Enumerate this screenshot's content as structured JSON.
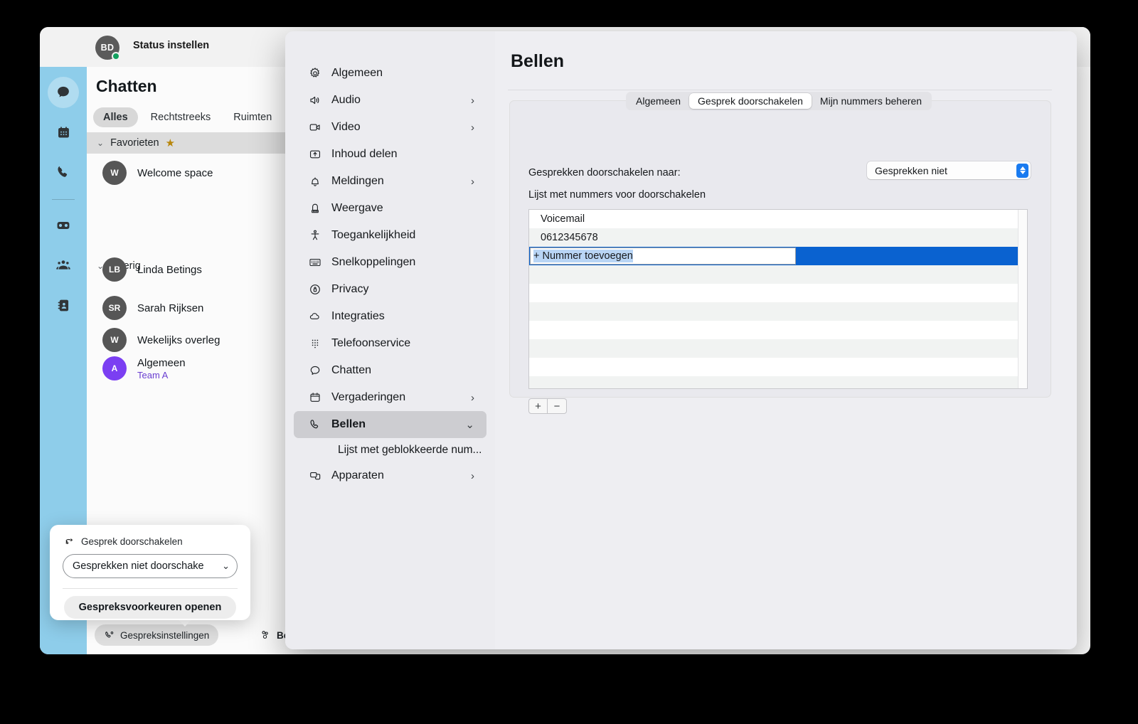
{
  "app": {
    "avatar_initials": "BD",
    "status_label": "Status instellen",
    "chat_title": "Chatten",
    "chat_tabs": [
      {
        "label": "Alles",
        "selected": true
      },
      {
        "label": "Rechtstreeks",
        "selected": false
      },
      {
        "label": "Ruimten",
        "selected": false
      }
    ],
    "groups": {
      "favorites_label": "Favorieten",
      "other_label": "Overig"
    },
    "favorites": [
      {
        "initials": "W",
        "name": "Welcome space",
        "color": "gray",
        "sub": ""
      }
    ],
    "other": [
      {
        "initials": "LB",
        "name": "Linda Betings",
        "color": "gray",
        "sub": ""
      },
      {
        "initials": "SR",
        "name": "Sarah Rijksen",
        "color": "gray",
        "sub": ""
      },
      {
        "initials": "W",
        "name": "Wekelijks overleg",
        "color": "gray",
        "sub": ""
      },
      {
        "initials": "A",
        "name": "Algemeen",
        "color": "purple",
        "sub": "Team A"
      }
    ],
    "rail_items": [
      {
        "name": "chat",
        "active": true
      },
      {
        "name": "calendar",
        "active": false
      },
      {
        "name": "calls",
        "active": false
      },
      {
        "name": "voicemail",
        "active": false
      },
      {
        "name": "teams",
        "active": false
      },
      {
        "name": "contacts",
        "active": false
      }
    ],
    "bottom_bar": {
      "call_settings_label": "Gespreksinstellingen",
      "availability_label": "Beschikbaar"
    },
    "popover": {
      "header_label": "Gesprek doorschakelen",
      "select_value": "Gesprekken niet doorschake",
      "button_label": "Gespreksvoorkeuren openen"
    }
  },
  "settings": {
    "nav": [
      {
        "label": "Algemeen",
        "icon": "gear-icon",
        "chevron": "",
        "selected": false
      },
      {
        "label": "Audio",
        "icon": "speaker-icon",
        "chevron": "›",
        "selected": false
      },
      {
        "label": "Video",
        "icon": "camera-icon",
        "chevron": "›",
        "selected": false
      },
      {
        "label": "Inhoud delen",
        "icon": "share-screen-icon",
        "chevron": "",
        "selected": false
      },
      {
        "label": "Meldingen",
        "icon": "bell-icon",
        "chevron": "›",
        "selected": false
      },
      {
        "label": "Weergave",
        "icon": "appearance-icon",
        "chevron": "",
        "selected": false
      },
      {
        "label": "Toegankelijkheid",
        "icon": "accessibility-icon",
        "chevron": "",
        "selected": false
      },
      {
        "label": "Snelkoppelingen",
        "icon": "keyboard-icon",
        "chevron": "",
        "selected": false
      },
      {
        "label": "Privacy",
        "icon": "lock-icon",
        "chevron": "",
        "selected": false
      },
      {
        "label": "Integraties",
        "icon": "cloud-icon",
        "chevron": "",
        "selected": false
      },
      {
        "label": "Telefoonservice",
        "icon": "dialpad-icon",
        "chevron": "",
        "selected": false
      },
      {
        "label": "Chatten",
        "icon": "chat-bubble-icon",
        "chevron": "",
        "selected": false
      },
      {
        "label": "Vergaderingen",
        "icon": "calendar-icon",
        "chevron": "›",
        "selected": false
      },
      {
        "label": "Bellen",
        "icon": "phone-icon",
        "chevron": "⌄",
        "selected": true
      },
      {
        "label": "Apparaten",
        "icon": "devices-icon",
        "chevron": "›",
        "selected": false
      }
    ],
    "nav_sub_item": "Lijst met geblokkeerde num...",
    "page_title": "Bellen",
    "tabs": [
      {
        "label": "Algemeen",
        "selected": false
      },
      {
        "label": "Gesprek doorschakelen",
        "selected": true
      },
      {
        "label": "Mijn nummers beheren",
        "selected": false
      }
    ],
    "forward_to_label": "Gesprekken doorschakelen naar:",
    "forward_to_value": "Gesprekken niet",
    "list_label": "Lijst met nummers voor doorschakelen",
    "list_rows": [
      {
        "text": "Voicemail",
        "selected": false,
        "editing": false
      },
      {
        "text": "0612345678",
        "selected": false,
        "editing": false
      },
      {
        "text": "+ Nummer toevoegen",
        "selected": true,
        "editing": true
      },
      {
        "text": "",
        "selected": false,
        "editing": false
      },
      {
        "text": "",
        "selected": false,
        "editing": false
      },
      {
        "text": "",
        "selected": false,
        "editing": false
      },
      {
        "text": "",
        "selected": false,
        "editing": false
      },
      {
        "text": "",
        "selected": false,
        "editing": false
      },
      {
        "text": "",
        "selected": false,
        "editing": false
      },
      {
        "text": "",
        "selected": false,
        "editing": false
      }
    ],
    "add_button_label": "+",
    "remove_button_label": "−"
  },
  "colors": {
    "rail_blue": "#8ecdea",
    "selection_blue": "#0a62d0",
    "stepper_blue": "#1a7bf0",
    "accent_purple": "#7b3ff2",
    "star_gold": "#b8860b"
  }
}
